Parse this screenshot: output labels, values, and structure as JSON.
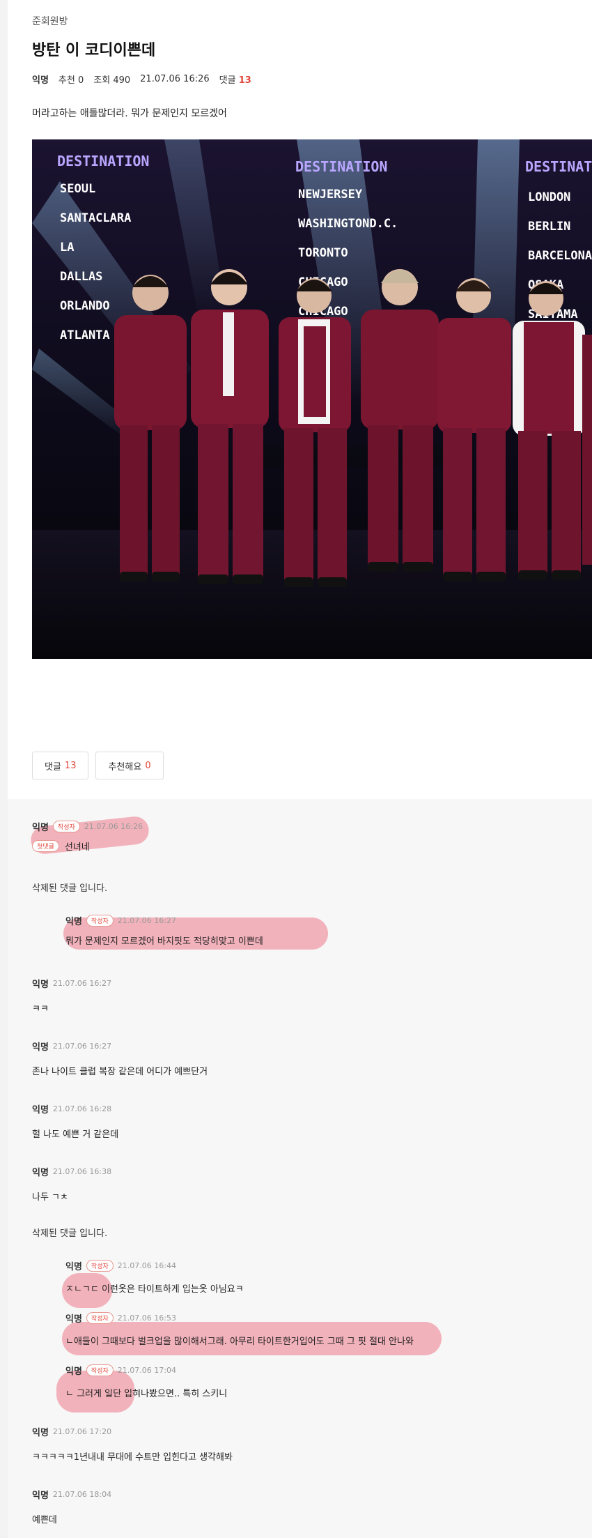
{
  "post": {
    "board": "준회원방",
    "title": "방탄 이 코디이쁜데",
    "author": "익명",
    "likes_label": "추천",
    "likes": "0",
    "views_label": "조회",
    "views": "490",
    "date": "21.07.06 16:26",
    "comments_label": "댓글",
    "comments_count": "13",
    "body": "머라고하는 애들많더라. 뭐가 문제인지 모르겠어"
  },
  "photo": {
    "boards": [
      {
        "header": "DESTINATION",
        "cities": [
          "SEOUL",
          "SANTACLARA",
          "LA",
          "DALLAS",
          "ORLANDO",
          "ATLANTA"
        ]
      },
      {
        "header": "DESTINATION",
        "cities": [
          "NEWJERSEY",
          "WASHINGTOND.C.",
          "TORONTO",
          "CHICAGO",
          "CHICAGO"
        ]
      },
      {
        "header": "DESTINATION",
        "cities": [
          "LONDON",
          "BERLIN",
          "BARCELONA",
          "OSAKA",
          "SAITAMA"
        ]
      }
    ]
  },
  "actions": {
    "comment_label": "댓글",
    "comment_count": "13",
    "recommend_label": "추천해요",
    "recommend_count": "0"
  },
  "comments": [
    {
      "author": "익명",
      "badge": "작성자",
      "time": "21.07.06 16:26",
      "reply_tag": "첫댓글",
      "text": "선녀네"
    },
    {
      "deleted": "삭제된 댓글 입니다."
    },
    {
      "author": "익명",
      "badge": "작성자",
      "time": "21.07.06 16:27",
      "text": "뭐가 문제인지 모르겠어 바지핏도 적당히맞고 이쁜데"
    },
    {
      "author": "익명",
      "time": "21.07.06 16:27",
      "text": "ㅋㅋ"
    },
    {
      "author": "익명",
      "time": "21.07.06 16:27",
      "text": "존나 나이트 클럽 복장 같은데 어디가 예쁘단거"
    },
    {
      "author": "익명",
      "time": "21.07.06 16:28",
      "text": "헐 나도 예쁜 거 같은데"
    },
    {
      "author": "익명",
      "time": "21.07.06 16:38",
      "text": "나두 ㄱㅊ"
    },
    {
      "deleted": "삭제된 댓글 입니다."
    },
    {
      "author": "익명",
      "badge": "작성자",
      "time": "21.07.06 16:44",
      "text": "ㅈㄴㄱㄷ 이런옷은 타이트하게 입는옷 아님요ㅋ"
    },
    {
      "author": "익명",
      "badge": "작성자",
      "time": "21.07.06 16:53",
      "text": "ㄴ애들이 그때보다 벌크업을 많이해서그래. 아무리 타이트한거입어도 그때 그 핏 절대 안나와"
    },
    {
      "author": "익명",
      "badge": "작성자",
      "time": "21.07.06 17:04",
      "text": "ㄴ 그러게 일단 입혀나봤으면.. 특히 스키니"
    },
    {
      "author": "익명",
      "time": "21.07.06 17:20",
      "text": "ㅋㅋㅋㅋㅋ1년내내 무대에 수트만 입힌다고 생각해봐"
    },
    {
      "author": "익명",
      "time": "21.07.06 18:04",
      "text": "예쁜데"
    }
  ],
  "colors": {
    "accent": "#e2463a",
    "highlight": "#ec5e70",
    "suit": "#7a1630",
    "screen_text": "#b9a6ff"
  }
}
